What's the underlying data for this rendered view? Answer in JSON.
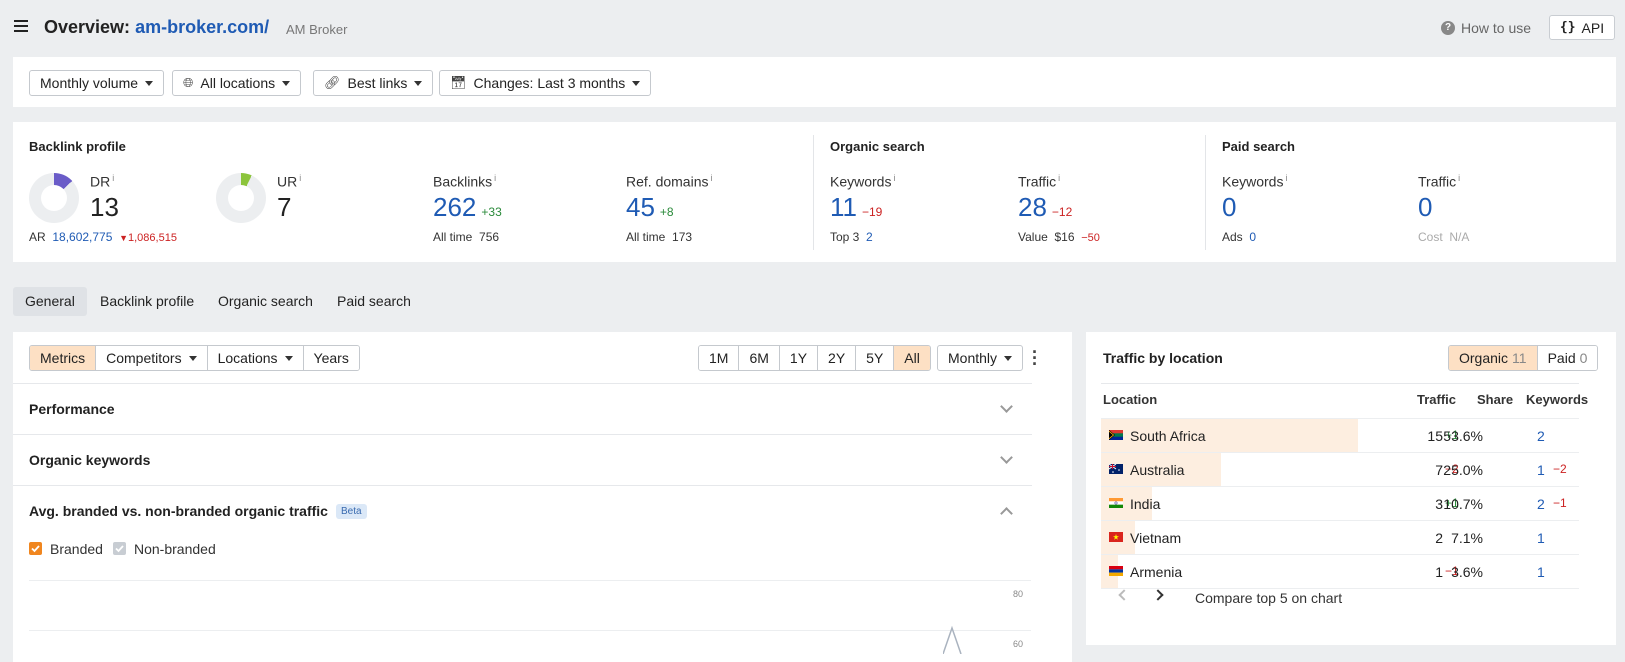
{
  "header": {
    "title_prefix": "Overview:",
    "domain": "am-broker.com/",
    "subtitle": "AM Broker",
    "how_to_use": "How to use",
    "api": "API"
  },
  "filters": {
    "volume": "Monthly volume",
    "locations": "All locations",
    "links": "Best links",
    "changes": "Changes: Last 3 months"
  },
  "backlink_profile": {
    "title": "Backlink profile",
    "dr_label": "DR",
    "dr_value": "13",
    "dr_fill": 0.13,
    "ur_label": "UR",
    "ur_value": "7",
    "ur_fill": 0.07,
    "ar_label": "AR",
    "ar_value": "18,602,775",
    "ar_delta": "1,086,515",
    "backlinks_label": "Backlinks",
    "backlinks_value": "262",
    "backlinks_delta": "+33",
    "backlinks_alltime_label": "All time",
    "backlinks_alltime": "756",
    "refdomains_label": "Ref. domains",
    "refdomains_value": "45",
    "refdomains_delta": "+8",
    "refdomains_alltime_label": "All time",
    "refdomains_alltime": "173"
  },
  "organic_search": {
    "title": "Organic search",
    "keywords_label": "Keywords",
    "keywords_value": "11",
    "keywords_delta": "−19",
    "top3_label": "Top 3",
    "top3_value": "2",
    "traffic_label": "Traffic",
    "traffic_value": "28",
    "traffic_delta": "−12",
    "value_label": "Value",
    "value_value": "$16",
    "value_delta": "−50"
  },
  "paid_search": {
    "title": "Paid search",
    "keywords_label": "Keywords",
    "keywords_value": "0",
    "ads_label": "Ads",
    "ads_value": "0",
    "traffic_label": "Traffic",
    "traffic_value": "0",
    "cost_label": "Cost",
    "cost_value": "N/A"
  },
  "tabs": [
    "General",
    "Backlink profile",
    "Organic search",
    "Paid search"
  ],
  "toolbar": {
    "metrics": "Metrics",
    "competitors": "Competitors",
    "locations": "Locations",
    "years": "Years",
    "ranges": [
      "1M",
      "6M",
      "1Y",
      "2Y",
      "5Y",
      "All"
    ],
    "interval": "Monthly"
  },
  "sections": {
    "performance": "Performance",
    "organic_keywords": "Organic keywords",
    "branded_title": "Avg. branded vs. non-branded organic traffic",
    "beta": "Beta",
    "branded": "Branded",
    "non_branded": "Non-branded",
    "y_ticks": [
      "80",
      "60"
    ]
  },
  "traffic_by_location": {
    "title": "Traffic by location",
    "organic_label": "Organic",
    "organic_count": "11",
    "paid_label": "Paid",
    "paid_count": "0",
    "columns": [
      "Location",
      "Traffic",
      "Share",
      "Keywords"
    ],
    "rows": [
      {
        "country": "South Africa",
        "traffic": "15",
        "traffic_delta": "+1",
        "share": "53.6%",
        "share_value": 53.6,
        "keywords": "2",
        "keywords_delta": ""
      },
      {
        "country": "Australia",
        "traffic": "7",
        "traffic_delta": "−2",
        "share": "25.0%",
        "share_value": 25.0,
        "keywords": "1",
        "keywords_delta": "−2"
      },
      {
        "country": "India",
        "traffic": "3",
        "traffic_delta": "+1",
        "share": "10.7%",
        "share_value": 10.7,
        "keywords": "2",
        "keywords_delta": "−1"
      },
      {
        "country": "Vietnam",
        "traffic": "2",
        "traffic_delta": "",
        "share": "7.1%",
        "share_value": 7.1,
        "keywords": "1",
        "keywords_delta": ""
      },
      {
        "country": "Armenia",
        "traffic": "1",
        "traffic_delta": "−1",
        "share": "3.6%",
        "share_value": 3.6,
        "keywords": "1",
        "keywords_delta": ""
      }
    ],
    "compare": "Compare top 5 on chart"
  }
}
